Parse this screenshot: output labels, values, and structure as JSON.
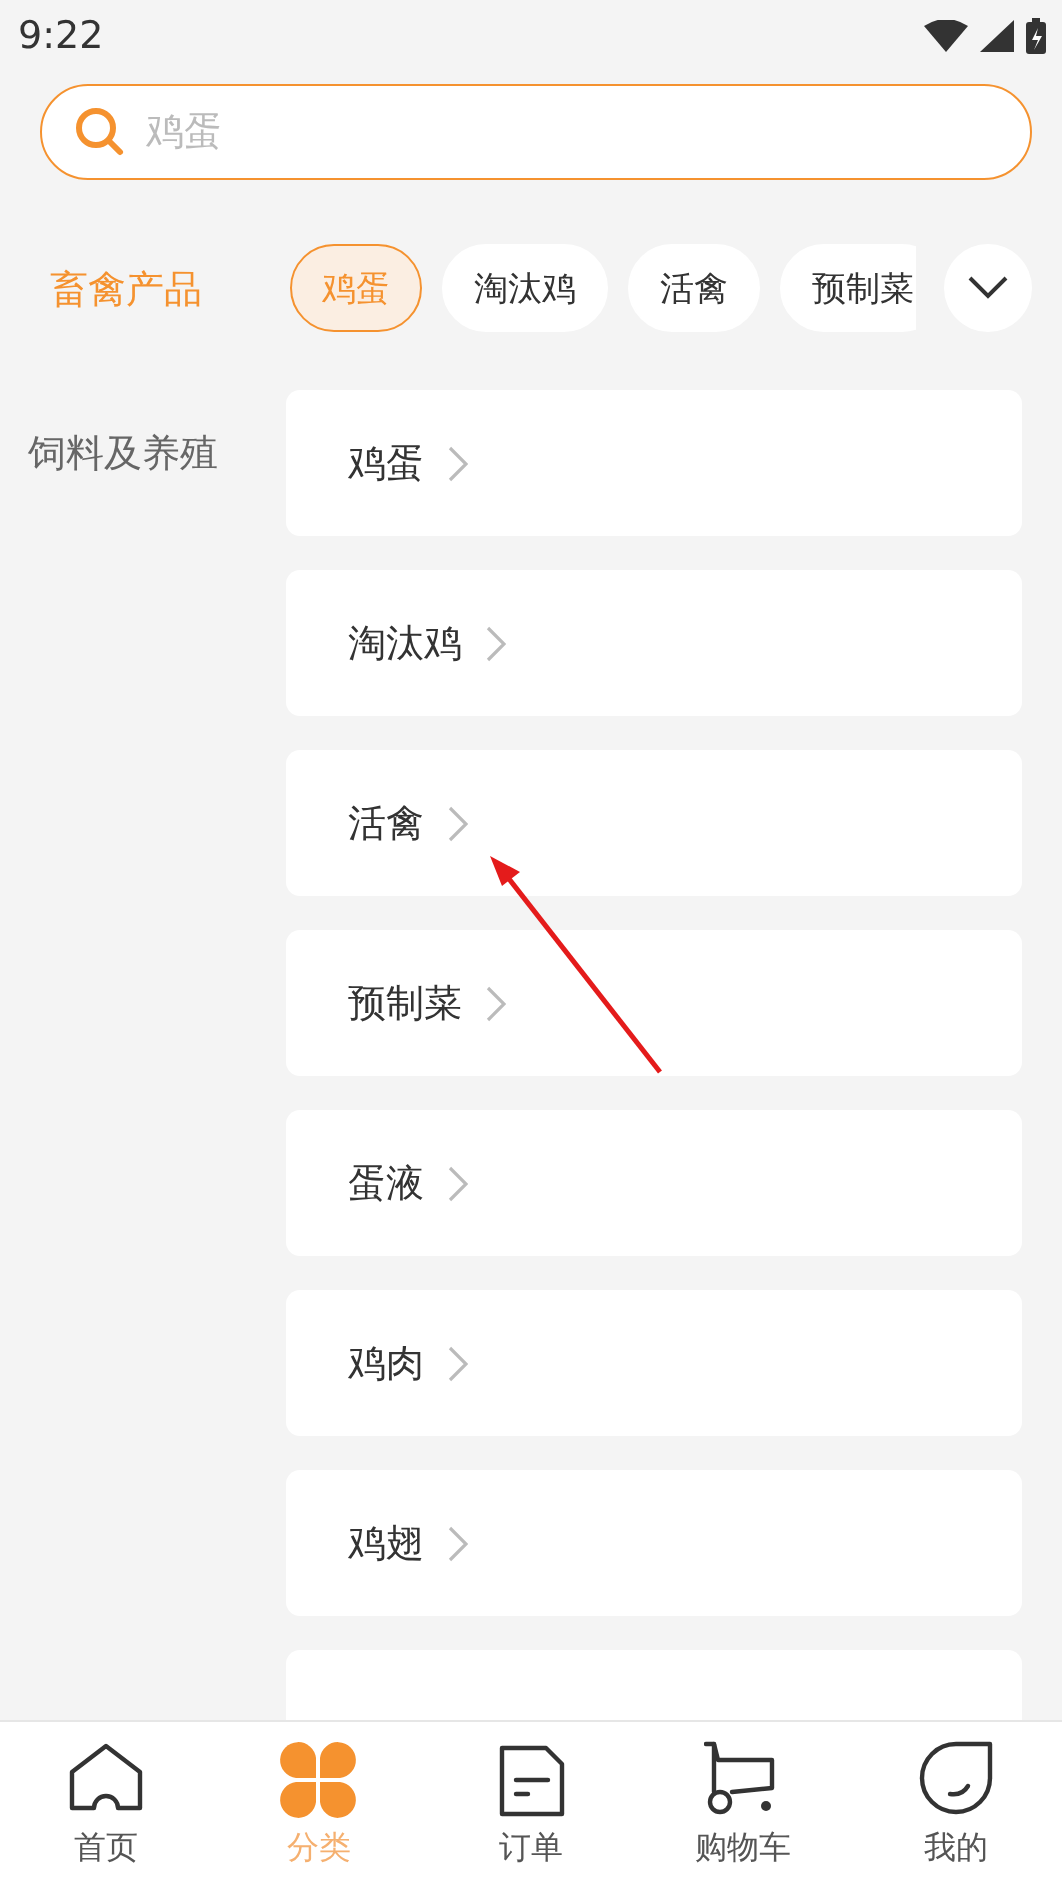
{
  "status_bar": {
    "time": "9:22"
  },
  "search": {
    "placeholder": "鸡蛋"
  },
  "sidebar": {
    "items": [
      {
        "label": "畜禽产品",
        "selected": true
      },
      {
        "label": "饲料及养殖",
        "selected": false
      }
    ]
  },
  "chips": [
    {
      "label": "鸡蛋",
      "selected": true
    },
    {
      "label": "淘汰鸡",
      "selected": false
    },
    {
      "label": "活禽",
      "selected": false
    },
    {
      "label": "预制菜",
      "selected": false
    }
  ],
  "categories": [
    {
      "label": "鸡蛋"
    },
    {
      "label": "淘汰鸡"
    },
    {
      "label": "活禽"
    },
    {
      "label": "预制菜"
    },
    {
      "label": "蛋液"
    },
    {
      "label": "鸡肉"
    },
    {
      "label": "鸡翅"
    },
    {
      "kind": "partial"
    }
  ],
  "tab_bar": [
    {
      "label": "首页",
      "kind": "home",
      "selected": false
    },
    {
      "label": "分类",
      "kind": "category",
      "selected": true
    },
    {
      "label": "订单",
      "kind": "order",
      "selected": false
    },
    {
      "label": "购物车",
      "kind": "cart",
      "selected": false
    },
    {
      "label": "我的",
      "kind": "me",
      "selected": false
    }
  ]
}
